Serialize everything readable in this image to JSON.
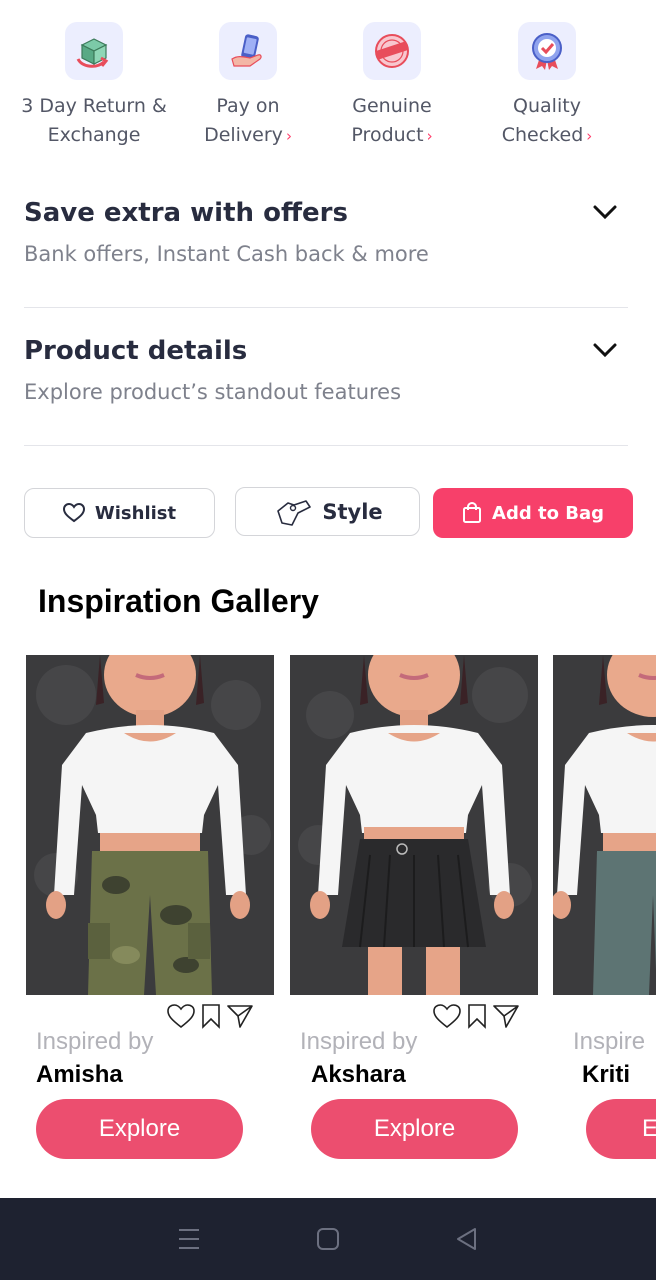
{
  "features": [
    {
      "line1": "3 Day Return &",
      "line2": "Exchange",
      "chevron": "",
      "icon": "return-box-icon"
    },
    {
      "line1": "Pay on",
      "line2": "Delivery",
      "chevron": "›",
      "icon": "pay-on-delivery-icon"
    },
    {
      "line1": "Genuine",
      "line2": "Product",
      "chevron": "›",
      "icon": "original-stamp-icon"
    },
    {
      "line1": "Quality",
      "line2": "Checked",
      "chevron": "›",
      "icon": "quality-badge-icon"
    }
  ],
  "offers": {
    "title": "Save extra with offers",
    "subtitle": "Bank offers, Instant Cash back & more"
  },
  "details": {
    "title": "Product details",
    "subtitle": "Explore product’s standout features"
  },
  "actions": {
    "wishlist": "Wishlist",
    "style": "Style",
    "bag": "Add to Bag"
  },
  "gallery": {
    "title": "Inspiration Gallery",
    "cards": [
      {
        "inspired": "Inspired by",
        "name": "Amisha",
        "explore": "Explore",
        "bottom": "cargo-pants"
      },
      {
        "inspired": "Inspired by",
        "name": "Akshara",
        "explore": "Explore",
        "bottom": "denim-skirt"
      },
      {
        "inspired": "Inspire",
        "name": "Kriti",
        "explore": "E",
        "bottom": "jeans"
      }
    ]
  },
  "colors": {
    "accent": "#ff3f6c",
    "button": "#f7406a",
    "explore": "#ec4e6f",
    "navbar": "#1e2230"
  }
}
